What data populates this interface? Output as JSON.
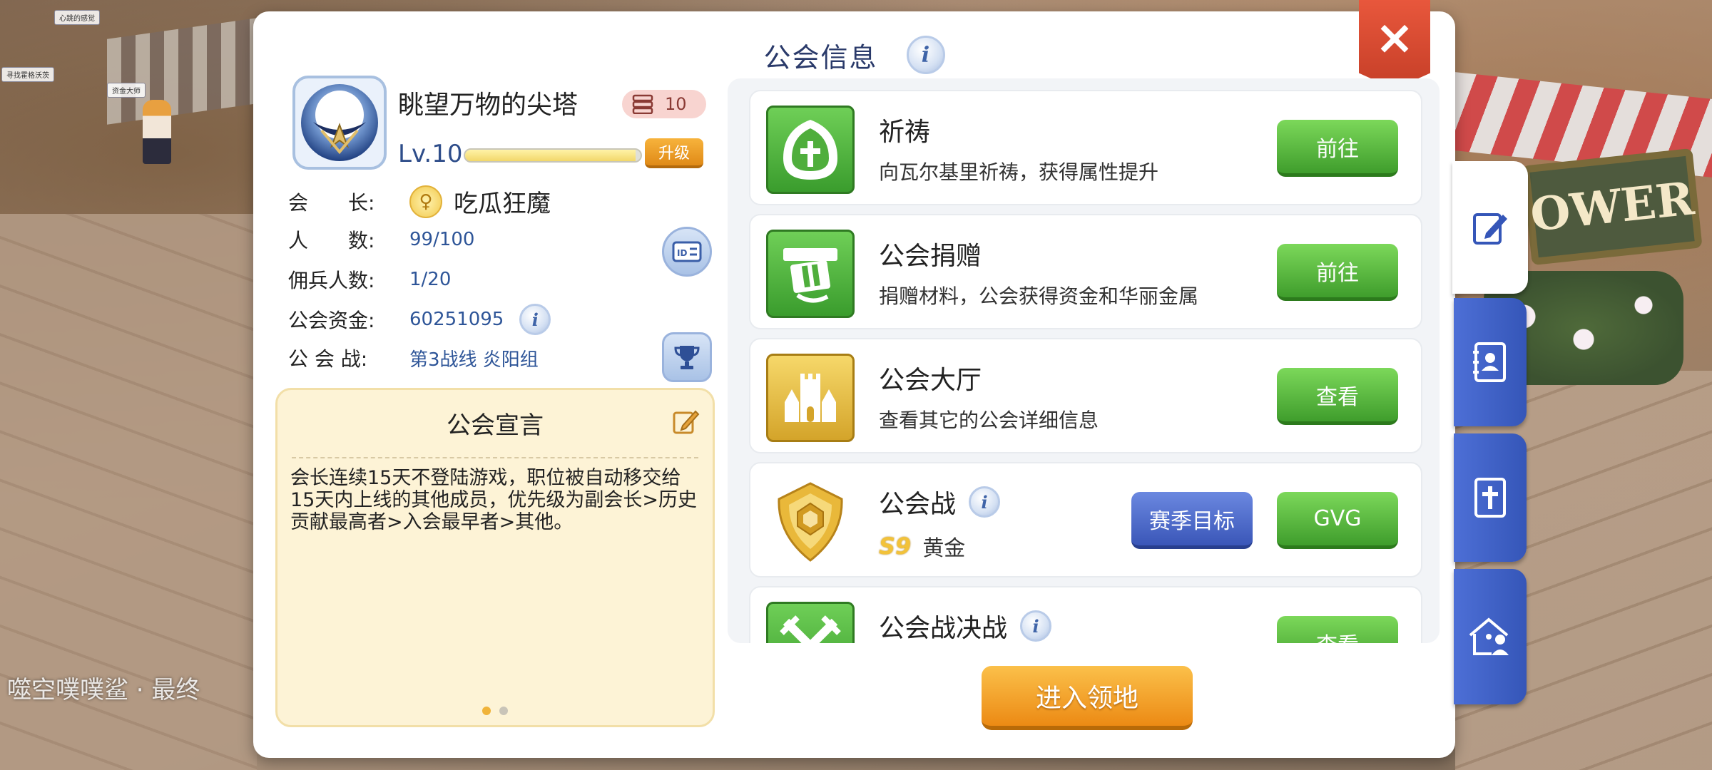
{
  "background": {
    "npc_labels": [
      "心跳的感觉",
      "寻找霍格沃茨",
      "资金大师"
    ],
    "player_name": "噬空噗噗鲨 · 最终",
    "sign_text": "OWER"
  },
  "dialog": {
    "title": "公会信息",
    "close_label": "×"
  },
  "guild": {
    "name": "眺望万物的尖塔",
    "member_badge": "10",
    "level": "Lv.10",
    "level_progress": 0.97,
    "upgrade_label": "升级",
    "leader_label": "会　　长:",
    "leader_name": "吃瓜狂魔",
    "members_label": "人　　数:",
    "members_value": "99/100",
    "mercenary_label": "佣兵人数:",
    "mercenary_value": "1/20",
    "funds_label": "公会资金:",
    "funds_value": "60251095",
    "war_label": "公 会 战:",
    "war_value": "第3战线 炎阳组"
  },
  "manifesto": {
    "title": "公会宣言",
    "text": "会长连续15天不登陆游戏，职位被自动移交给15天内上线的其他成员，优先级为副会长>历史贡献最高者>入会最早者>其他。",
    "page_count": 2,
    "current_page": 1
  },
  "activities": [
    {
      "title": "祈祷",
      "desc": "向瓦尔基里祈祷，获得属性提升",
      "button": "前往"
    },
    {
      "title": "公会捐赠",
      "desc": "捐赠材料，公会获得资金和华丽金属",
      "button": "前往"
    },
    {
      "title": "公会大厅",
      "desc": "查看其它的公会详细信息",
      "button": "查看"
    },
    {
      "title": "公会战",
      "season": "S9",
      "rank": "黄金",
      "button_secondary": "赛季目标",
      "button": "GVG"
    },
    {
      "title": "公会战决战",
      "button": "查看"
    }
  ],
  "enter_button": "进入领地",
  "side_tabs": [
    "edit-icon",
    "contact-book-icon",
    "cross-banner-icon",
    "guild-house-icon"
  ],
  "colors": {
    "title": "#2a3a6a",
    "green_button": "#4caf35",
    "blue_button": "#3a56b8",
    "orange_button": "#ec8a14",
    "close_red": "#d64a30",
    "side_tab_blue": "#3f5fc4"
  }
}
